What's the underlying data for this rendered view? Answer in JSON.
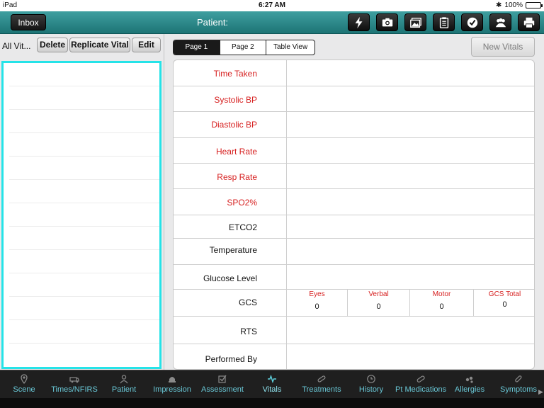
{
  "statusbar": {
    "device": "iPad",
    "time": "6:27 AM",
    "battery": "100%"
  },
  "header": {
    "inbox_label": "Inbox",
    "patient_label": "Patient:",
    "tools": [
      "lightning-icon",
      "camera-icon",
      "gallery-icon",
      "clipboard-icon",
      "checkmark-icon",
      "people-icon",
      "printer-icon"
    ]
  },
  "left": {
    "all_vitals": "All Vit...",
    "delete_label": "Delete",
    "replicate_label": "Replicate Vital",
    "edit_label": "Edit"
  },
  "right": {
    "segments": [
      "Page 1",
      "Page 2",
      "Table View"
    ],
    "new_vitals_label": "New Vitals",
    "fields": {
      "time_taken": "Time Taken",
      "systolic": "Systolic BP",
      "diastolic": "Diastolic BP",
      "heart_rate": "Heart Rate",
      "resp_rate": "Resp Rate",
      "spo2": "SPO2%",
      "etco2": "ETCO2",
      "temperature": "Temperature",
      "glucose": "Glucose Level",
      "gcs": "GCS",
      "rts": "RTS",
      "performed_by": "Performed By"
    },
    "gcs": {
      "eyes_label": "Eyes",
      "eyes_value": "0",
      "verbal_label": "Verbal",
      "verbal_value": "0",
      "motor_label": "Motor",
      "motor_value": "0",
      "total_label": "GCS Total",
      "total_value": "0"
    }
  },
  "tabs": [
    "Scene",
    "Times/NFIRS",
    "Patient",
    "Impression",
    "Assessment",
    "Vitals",
    "Treatments",
    "History",
    "Pt Medications",
    "Allergies",
    "Symptoms"
  ],
  "colors": {
    "header": "#2a8a8b",
    "required": "#d61f1f",
    "list_border": "#25e3e8",
    "tab_text": "#69c7d6"
  }
}
